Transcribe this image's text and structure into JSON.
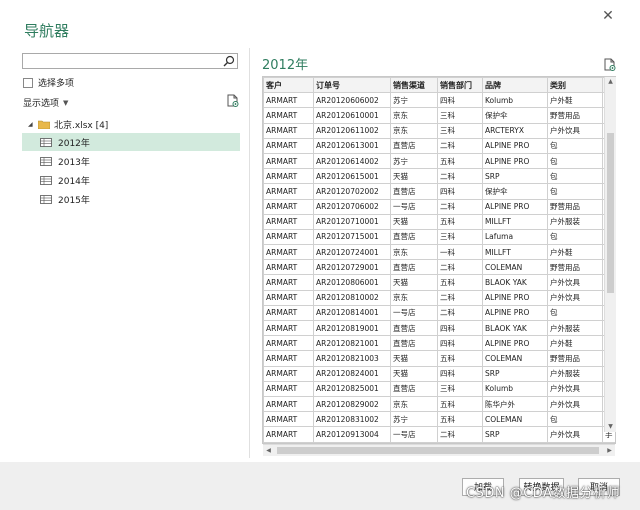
{
  "window": {
    "title": "导航器",
    "close_glyph": "✕"
  },
  "left": {
    "search_placeholder": "",
    "multi_select_label": "选择多项",
    "display_options_label": "显示选项",
    "tree": {
      "root_label": "北京.xlsx [4]",
      "items": [
        {
          "label": "2012年",
          "selected": true
        },
        {
          "label": "2013年",
          "selected": false
        },
        {
          "label": "2014年",
          "selected": false
        },
        {
          "label": "2015年",
          "selected": false
        }
      ]
    }
  },
  "preview": {
    "title": "2012年",
    "headers": [
      "客户",
      "订单号",
      "销售渠道",
      "销售部门",
      "品牌",
      "类别",
      "品名"
    ],
    "rows": [
      [
        "ARMART",
        "AR20120606002",
        "苏宁",
        "四科",
        "Kolumb",
        "户外鞋",
        "登"
      ],
      [
        "ARMART",
        "AR20120610001",
        "京东",
        "三科",
        "保护伞",
        "野营用品",
        "帐"
      ],
      [
        "ARMART",
        "AR20120611002",
        "京东",
        "三科",
        "ARCTERYX",
        "户外饮具",
        "气"
      ],
      [
        "ARMART",
        "AR20120613001",
        "直营店",
        "二科",
        "ALPINE PRO",
        "包",
        "手"
      ],
      [
        "ARMART",
        "AR20120614002",
        "苏宁",
        "五科",
        "ALPINE PRO",
        "包",
        "旅"
      ],
      [
        "ARMART",
        "AR20120615001",
        "天猫",
        "二科",
        "SRP",
        "包",
        "户"
      ],
      [
        "ARMART",
        "AR20120702002",
        "直营店",
        "四科",
        "保护伞",
        "包",
        "生"
      ],
      [
        "ARMART",
        "AR20120706002",
        "一号店",
        "二科",
        "ALPINE PRO",
        "野营用品",
        "地"
      ],
      [
        "ARMART",
        "AR20120710001",
        "天猫",
        "五科",
        "MILLFT",
        "户外服装",
        "手"
      ],
      [
        "ARMART",
        "AR20120715001",
        "直营店",
        "三科",
        "Lafuma",
        "包",
        "手"
      ],
      [
        "ARMART",
        "AR20120724001",
        "京东",
        "一科",
        "MILLFT",
        "户外鞋",
        "徒"
      ],
      [
        "ARMART",
        "AR20120729001",
        "直营店",
        "二科",
        "COLEMAN",
        "野营用品",
        "野"
      ],
      [
        "ARMART",
        "AR20120806001",
        "天猫",
        "五科",
        "BLAOK YAK",
        "户外饮具",
        "户"
      ],
      [
        "ARMART",
        "AR20120810002",
        "京东",
        "二科",
        "ALPINE PRO",
        "户外饮具",
        "攀"
      ],
      [
        "ARMART",
        "AR20120814001",
        "一号店",
        "二科",
        "ALPINE PRO",
        "包",
        "户"
      ],
      [
        "ARMART",
        "AR20120819001",
        "直营店",
        "四科",
        "BLAOK YAK",
        "户外服装",
        "速"
      ],
      [
        "ARMART",
        "AR20120821001",
        "直营店",
        "四科",
        "ALPINE PRO",
        "户外鞋",
        "防"
      ],
      [
        "ARMART",
        "AR20120821003",
        "天猫",
        "五科",
        "COLEMAN",
        "野营用品",
        "野"
      ],
      [
        "ARMART",
        "AR20120824001",
        "天猫",
        "四科",
        "SRP",
        "户外服装",
        "户"
      ],
      [
        "ARMART",
        "AR20120825001",
        "直营店",
        "三科",
        "Kolumb",
        "户外饮具",
        "套"
      ],
      [
        "ARMART",
        "AR20120829002",
        "京东",
        "五科",
        "陈华户外",
        "户外饮具",
        "户"
      ],
      [
        "ARMART",
        "AR20120831002",
        "苏宁",
        "五科",
        "COLEMAN",
        "包",
        "收"
      ],
      [
        "ARMART",
        "AR20120913004",
        "一号店",
        "二科",
        "SRP",
        "户外饮具",
        "手"
      ]
    ]
  },
  "footer": {
    "load_label": "加载",
    "transform_label": "转换数据",
    "cancel_label": "取消",
    "watermark": "CSDN @CDA数据分析师"
  },
  "colors": {
    "accent": "#2f7d5f",
    "selected_bg": "#d2eadd",
    "footer_bg": "#efefef"
  },
  "icons": {
    "search": "search-icon",
    "folder": "folder-icon",
    "sheet": "sheet-icon",
    "preview": "preview-icon",
    "close": "close-icon"
  }
}
